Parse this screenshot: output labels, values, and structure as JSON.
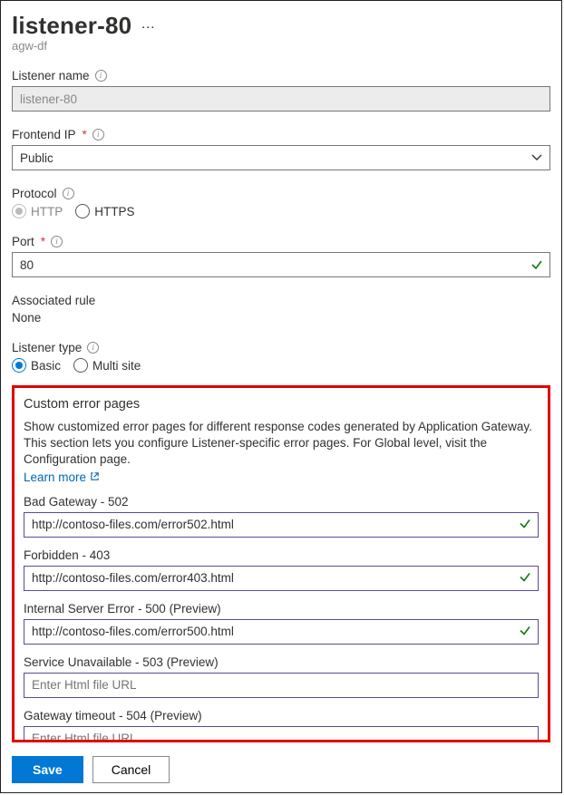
{
  "header": {
    "title": "listener-80",
    "subtitle": "agw-df"
  },
  "fields": {
    "listener_name": {
      "label": "Listener name",
      "value": "listener-80"
    },
    "frontend_ip": {
      "label": "Frontend IP",
      "value": "Public"
    },
    "protocol": {
      "label": "Protocol",
      "options": {
        "http": "HTTP",
        "https": "HTTPS"
      },
      "selected": "http"
    },
    "port": {
      "label": "Port",
      "value": "80"
    },
    "associated_rule": {
      "label": "Associated rule",
      "value": "None"
    },
    "listener_type": {
      "label": "Listener type",
      "options": {
        "basic": "Basic",
        "multi": "Multi site"
      },
      "selected": "basic"
    }
  },
  "custom_error": {
    "title": "Custom error pages",
    "description": "Show customized error pages for different response codes generated by Application Gateway. This section lets you configure Listener-specific error pages. For Global level, visit the Configuration page.",
    "learn_more": "Learn more",
    "placeholder": "Enter Html file URL",
    "items": [
      {
        "label": "Bad Gateway - 502",
        "value": "http://contoso-files.com/error502.html",
        "valid": true
      },
      {
        "label": "Forbidden - 403",
        "value": "http://contoso-files.com/error403.html",
        "valid": true
      },
      {
        "label": "Internal Server Error - 500 (Preview)",
        "value": "http://contoso-files.com/error500.html",
        "valid": true
      },
      {
        "label": "Service Unavailable - 503 (Preview)",
        "value": "",
        "valid": false
      },
      {
        "label": "Gateway timeout - 504 (Preview)",
        "value": "",
        "valid": false
      }
    ]
  },
  "footer": {
    "save": "Save",
    "cancel": "Cancel"
  }
}
